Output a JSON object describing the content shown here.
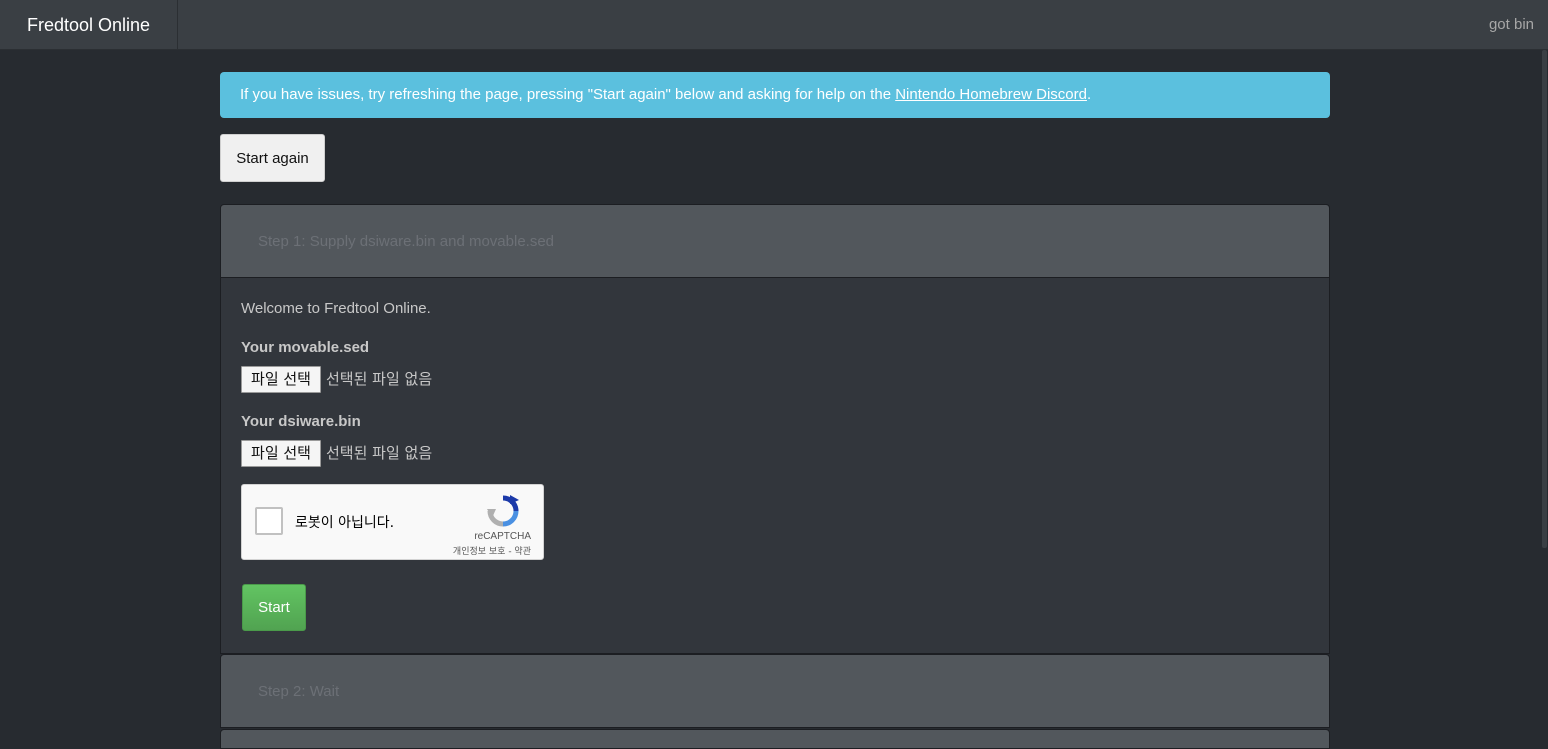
{
  "navbar": {
    "brand": "Fredtool Online",
    "right_link": "got bin"
  },
  "alert": {
    "text": "If you have issues, try refreshing the page, pressing \"Start again\" below and asking for help on the ",
    "link_text": "Nintendo Homebrew Discord",
    "suffix": "."
  },
  "start_again_label": "Start again",
  "step1": {
    "title": "Step 1: Supply dsiware.bin and movable.sed",
    "welcome": "Welcome to Fredtool Online.",
    "movable_label": "Your movable.sed",
    "dsiware_label": "Your dsiware.bin",
    "file_button": "파일 선택",
    "file_status": "선택된 파일 없음",
    "captcha": {
      "text": "로봇이 아닙니다.",
      "brand": "reCAPTCHA",
      "links": "개인정보 보호 - 약관"
    },
    "start_label": "Start"
  },
  "step2": {
    "title": "Step 2: Wait"
  }
}
